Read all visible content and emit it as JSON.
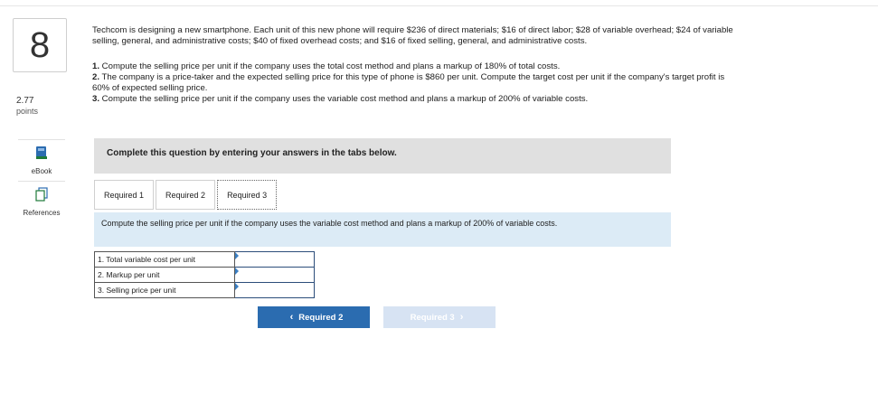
{
  "question": {
    "number": "8",
    "points_value": "2.77",
    "points_label": "points"
  },
  "side": {
    "ebook_label": "eBook",
    "references_label": "References"
  },
  "problem": {
    "intro": "Techcom is designing a new smartphone. Each unit of this new phone will require $236 of direct materials; $16 of direct labor; $28 of variable overhead; $24 of variable selling, general, and administrative costs; $40 of fixed overhead costs; and $16 of fixed selling, general, and administrative costs.",
    "requirements": [
      {
        "num": "1.",
        "text": " Compute the selling price per unit if the company uses the total cost method and plans a markup of 180% of total costs."
      },
      {
        "num": "2.",
        "text": " The company is a price-taker and the expected selling price for this type of phone is $860 per unit. Compute the target cost per unit if the company's target profit is 60% of expected selling price."
      },
      {
        "num": "3.",
        "text": " Compute the selling price per unit if the company uses the variable cost method and plans a markup of 200% of variable costs."
      }
    ]
  },
  "banner": "Complete this question by entering your answers in the tabs below.",
  "tabs": [
    "Required 1",
    "Required 2",
    "Required 3"
  ],
  "active_tab": "Required 3",
  "instruction": "Compute the selling price per unit if the company uses the variable cost method and plans a markup of 200% of variable costs.",
  "answer_rows": [
    {
      "label": "1. Total variable cost per unit",
      "value": ""
    },
    {
      "label": "2. Markup per unit",
      "value": ""
    },
    {
      "label": "3. Selling price per unit",
      "value": ""
    }
  ],
  "nav": {
    "prev_label": "Required 2",
    "next_label": "Required 3"
  },
  "colors": {
    "primary_button": "#2b6cb0",
    "disabled_button": "#d7e3f3",
    "instruction_bg": "#dcebf6",
    "banner_bg": "#e0e0e0"
  }
}
